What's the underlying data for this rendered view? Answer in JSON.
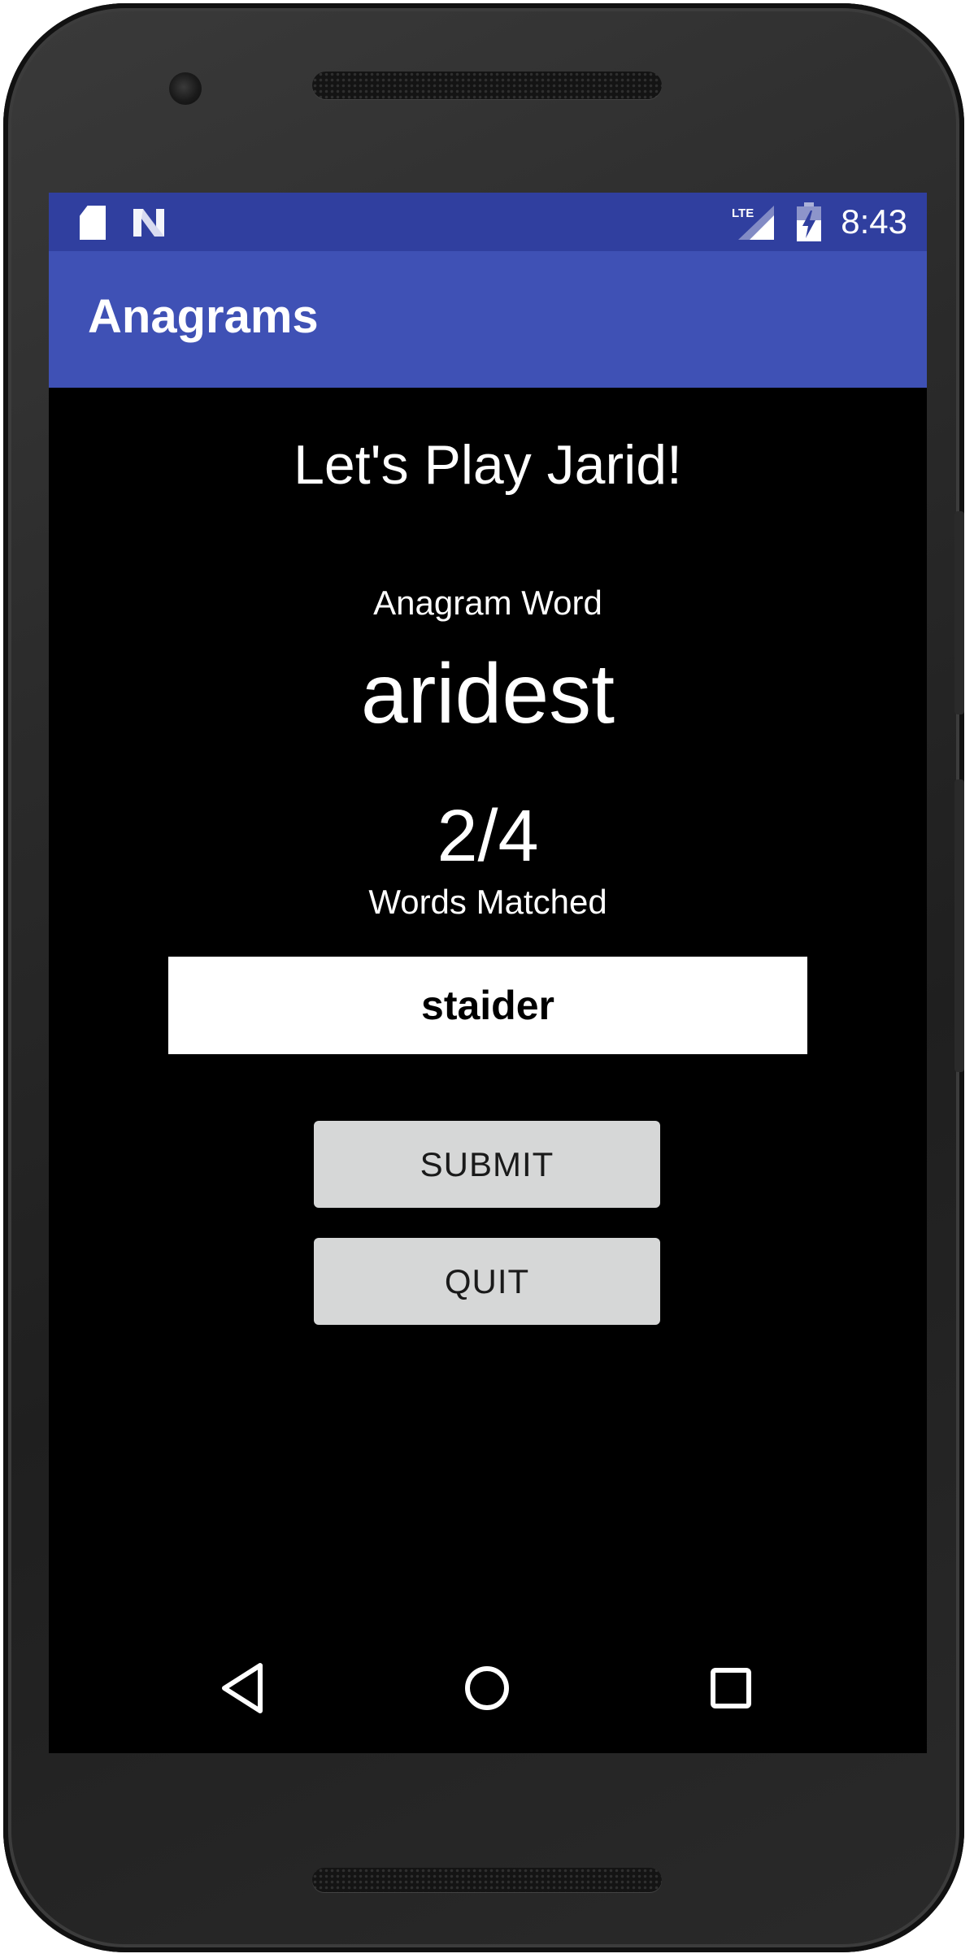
{
  "status_bar": {
    "time": "8:43",
    "icons": [
      "sd-card-icon",
      "n-notification-icon",
      "lte-signal-icon",
      "battery-charging-icon"
    ],
    "network_label": "LTE"
  },
  "app_bar": {
    "title": "Anagrams"
  },
  "game": {
    "greeting": "Let's Play Jarid!",
    "anagram_label": "Anagram Word",
    "anagram_word": "aridest",
    "progress": "2/4",
    "matched_label": "Words Matched",
    "answer_value": "staider"
  },
  "buttons": {
    "submit_label": "SUBMIT",
    "quit_label": "QUIT"
  },
  "nav_bar": {
    "icons": [
      "back-icon",
      "home-icon",
      "recents-icon"
    ]
  },
  "colors": {
    "status_bar": "#303f9f",
    "app_bar": "#3f51b5",
    "background": "#000000",
    "button": "#d6d7d7",
    "text": "#ffffff"
  }
}
